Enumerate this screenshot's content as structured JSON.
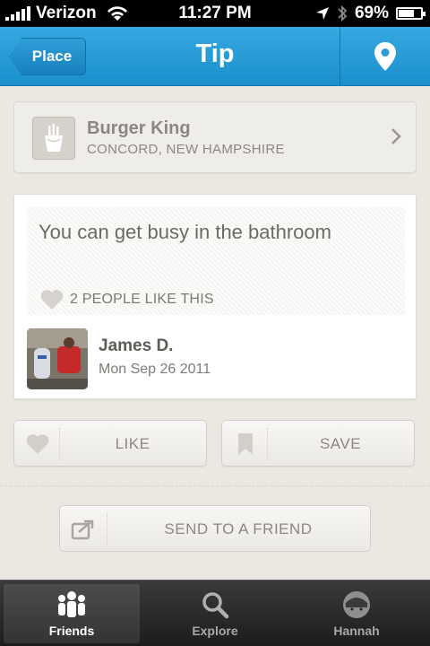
{
  "status_bar": {
    "carrier": "Verizon",
    "time": "11:27 PM",
    "battery": "69%",
    "battery_level": 0.69
  },
  "nav": {
    "back_label": "Place",
    "title": "Tip",
    "right_icon": "map-pin-icon"
  },
  "venue": {
    "icon": "fries-icon",
    "name": "Burger King",
    "location": "CONCORD, NEW HAMPSHIRE"
  },
  "tip": {
    "text": "You can get busy in the bathroom",
    "likes_text": "2 PEOPLE LIKE THIS",
    "author_name": "James D.",
    "date": "Mon Sep 26 2011"
  },
  "actions": {
    "like_label": "LIKE",
    "save_label": "SAVE",
    "send_label": "SEND TO A FRIEND"
  },
  "tabs": [
    {
      "label": "Friends",
      "icon": "friends-icon",
      "active": true
    },
    {
      "label": "Explore",
      "icon": "search-icon",
      "active": false
    },
    {
      "label": "Hannah",
      "icon": "profile-icon",
      "active": false
    }
  ],
  "colors": {
    "nav_blue": "#1f94d1",
    "background": "#ebe8e2",
    "tabbar": "#2a2a2a"
  }
}
